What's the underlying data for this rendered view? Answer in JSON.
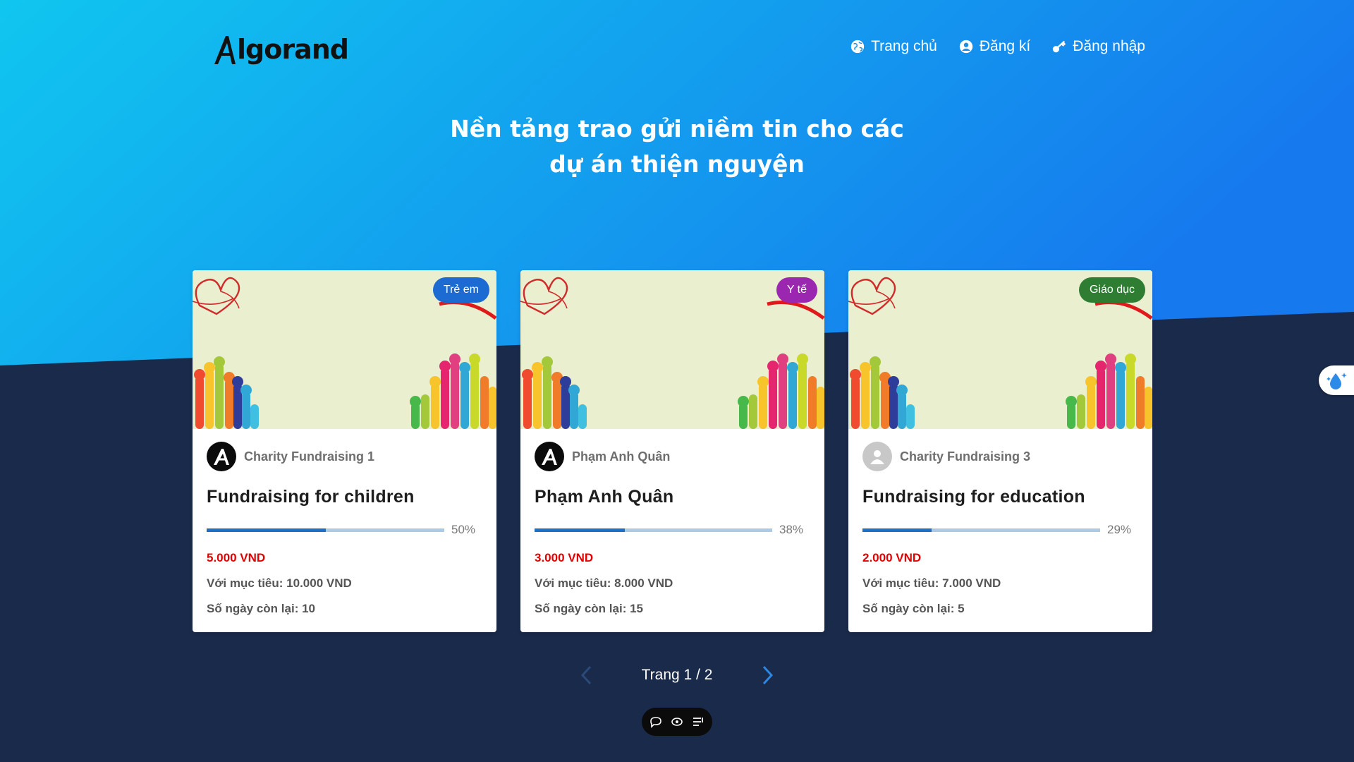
{
  "colors": {
    "hero_gradient_start": "#10c6ef",
    "hero_gradient_end": "#1679ee",
    "background_dark": "#1a2a4a",
    "progress_fill": "#1f6fc4",
    "progress_track": "#a9cbe8",
    "raised_text": "#e20000"
  },
  "header": {
    "logo_text": "lgorand",
    "nav": [
      {
        "label": "Trang chủ",
        "icon": "globe-icon"
      },
      {
        "label": "Đăng kí",
        "icon": "user-circle-icon"
      },
      {
        "label": "Đăng nhập",
        "icon": "key-icon"
      }
    ]
  },
  "hero": {
    "title_line1": "Nền tảng trao gửi niềm tin cho các",
    "title_line2": "dự án thiện nguyện"
  },
  "cards": [
    {
      "badge": "Trẻ em",
      "badge_color": "#1b6bd2",
      "avatar": "algorand-logo",
      "org": "Charity Fundraising 1",
      "title": "Fundraising for children",
      "progress": 50,
      "progress_label": "50%",
      "raised": "5.000 VND",
      "goal": "Với mục tiêu: 10.000 VND",
      "days": "Số ngày còn lại: 10"
    },
    {
      "badge": "Y tế",
      "badge_color": "#9b27b0",
      "avatar": "algorand-logo",
      "org": "Phạm Anh Quân",
      "title": "Phạm Anh Quân",
      "progress": 38,
      "progress_label": "38%",
      "raised": "3.000 VND",
      "goal": "Với mục tiêu: 8.000 VND",
      "days": "Số ngày còn lại: 15"
    },
    {
      "badge": "Giáo dục",
      "badge_color": "#2e7d32",
      "avatar": "default-user",
      "org": "Charity Fundraising 3",
      "title": "Fundraising for education",
      "progress": 29,
      "progress_label": "29%",
      "raised": "2.000 VND",
      "goal": "Với mục tiêu: 7.000 VND",
      "days": "Số ngày còn lại: 5"
    }
  ],
  "pagination": {
    "label": "Trang 1 / 2",
    "prev_icon": "chevron-left-icon",
    "next_icon": "chevron-right-icon"
  },
  "toolbar": {
    "icons": [
      "comment-icon",
      "eye-icon",
      "list-icon"
    ]
  },
  "side_widget": {
    "icon": "water-drop-sparkle-icon"
  }
}
